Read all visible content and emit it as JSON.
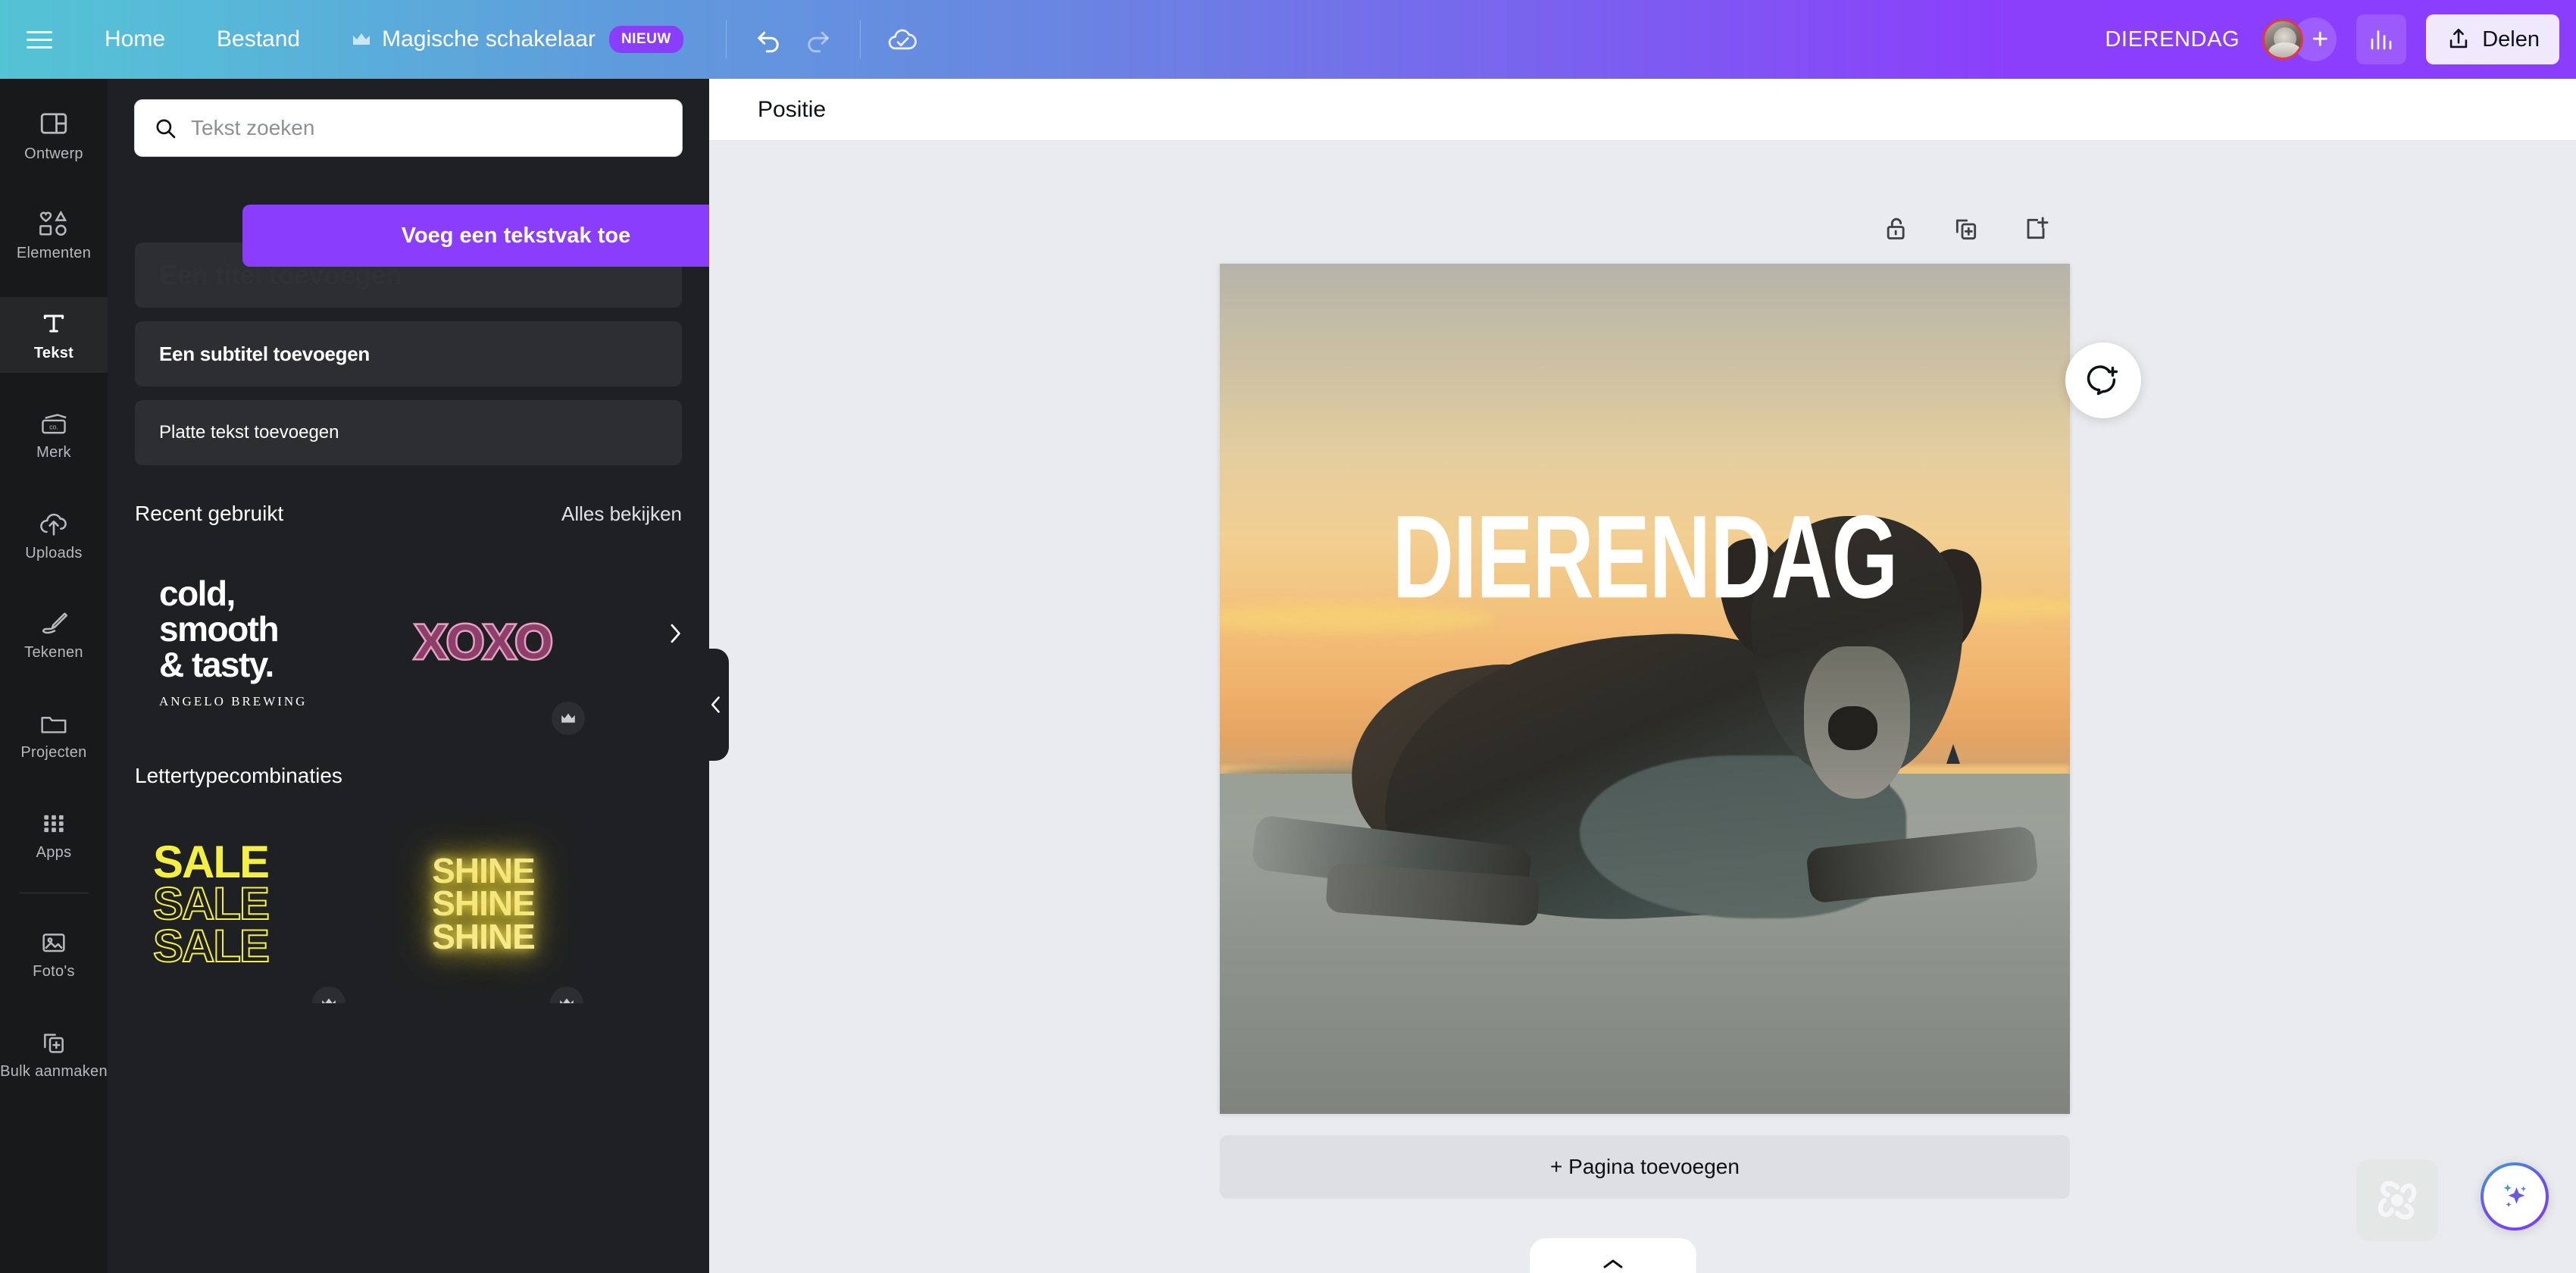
{
  "topbar": {
    "menu_icon": "hamburger-icon",
    "home_label": "Home",
    "file_label": "Bestand",
    "magic_switch_label": "Magische schakelaar",
    "magic_switch_icon": "crown-icon",
    "new_badge": "NIEUW",
    "undo_icon": "undo-icon",
    "redo_icon": "redo-icon",
    "cloud_saved_icon": "cloud-check-icon",
    "document_title": "DIERENDAG",
    "avatar_name": "user-avatar",
    "invite_label": "+",
    "stats_icon": "bar-chart-icon",
    "share_icon": "share-upload-icon",
    "share_label": "Delen"
  },
  "rail": {
    "items": [
      {
        "label": "Ontwerp",
        "icon": "layout-icon",
        "active": false
      },
      {
        "label": "Elementen",
        "icon": "shapes-icon",
        "active": false
      },
      {
        "label": "Tekst",
        "icon": "text-t-icon",
        "active": true
      },
      {
        "label": "Merk",
        "icon": "brand-card-icon",
        "active": false
      },
      {
        "label": "Uploads",
        "icon": "upload-cloud-icon",
        "active": false
      },
      {
        "label": "Tekenen",
        "icon": "pen-draw-icon",
        "active": false
      },
      {
        "label": "Projecten",
        "icon": "folder-icon",
        "active": false
      },
      {
        "label": "Apps",
        "icon": "grid-apps-icon",
        "active": false
      },
      {
        "label": "Foto's",
        "icon": "photo-icon",
        "active": false
      },
      {
        "label": "Bulk aanmaken",
        "icon": "bulk-create-icon",
        "active": false
      }
    ]
  },
  "panel": {
    "search": {
      "placeholder": "Tekst zoeken",
      "value": "",
      "icon": "search-icon"
    },
    "add_textbox_button": "Voeg een tekstvak toe",
    "styles": [
      {
        "label": "Een titel toevoegen",
        "kind": "title"
      },
      {
        "label": "Een subtitel toevoegen",
        "kind": "subtitle"
      },
      {
        "label": "Platte tekst toevoegen",
        "kind": "body"
      }
    ],
    "recent": {
      "title": "Recent gebruikt",
      "view_all": "Alles bekijken",
      "next_icon": "chevron-right-icon",
      "cards": [
        {
          "name": "cold-smooth-tasty-tile",
          "lines": [
            "cold,",
            "smooth",
            "& tasty."
          ],
          "brand": "ANGELO BREWING",
          "pro": false
        },
        {
          "name": "xoxo-tile",
          "text": "XOXO",
          "pro": true,
          "pro_icon": "crown-icon"
        }
      ]
    },
    "fontcombos": {
      "title": "Lettertypecombinaties",
      "cards": [
        {
          "name": "sale-tile",
          "lines": [
            "SALE",
            "SALE",
            "SALE"
          ],
          "pro": true,
          "pro_icon": "crown-icon"
        },
        {
          "name": "shine-tile",
          "lines": [
            "SHINE",
            "SHINE",
            "SHINE"
          ],
          "pro": true,
          "pro_icon": "crown-icon"
        }
      ]
    },
    "collapse_icon": "chevron-left-icon"
  },
  "main": {
    "toolbar_label": "Positie",
    "canvas_tools": [
      {
        "name": "lock-icon",
        "title": "unlock"
      },
      {
        "name": "duplicate-icon",
        "title": "duplicate"
      },
      {
        "name": "add-page-icon",
        "title": "add page"
      }
    ],
    "comment_icon": "add-comment-icon",
    "design": {
      "title_text": "DIERENDAG",
      "photo_alt": "dog-on-beach-at-sunset"
    },
    "add_page_label": "+ Pagina toevoegen",
    "bottom_tab_icon": "chevron-up-icon",
    "watermark_icon": "canva-logo-icon",
    "ai_icon": "magic-sparkle-icon"
  },
  "colors": {
    "accent_purple": "#8b3dfc",
    "topbar_start": "#54c3d4",
    "topbar_end": "#8b3dfc",
    "panel_bg": "#1f2023",
    "rail_bg": "#18191b",
    "canvas_bg": "#e9ebee",
    "avatar_ring": "#e03b3b",
    "neon_yellow": "#f4ef43",
    "xoxo_pink": "#e6a0bf"
  }
}
